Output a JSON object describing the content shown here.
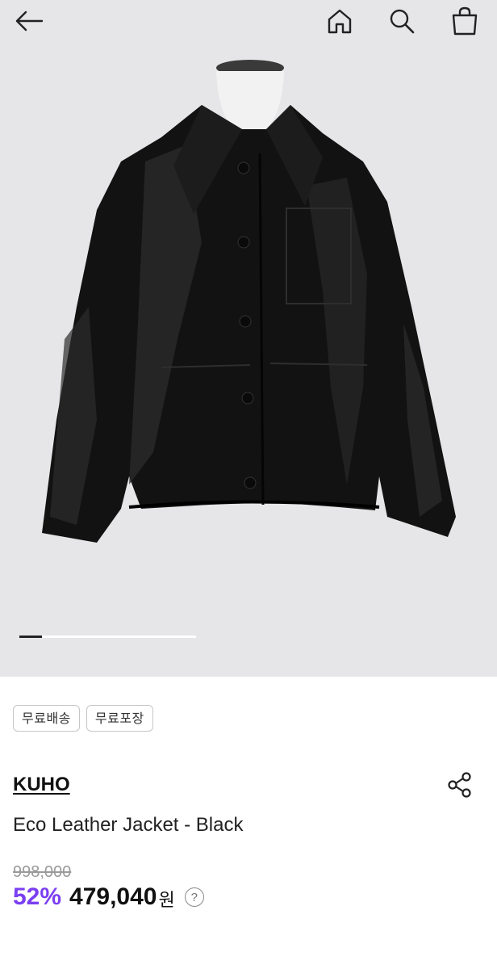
{
  "header": {
    "back_icon": "arrow-left-icon",
    "home_icon": "home-icon",
    "search_icon": "search-icon",
    "cart_icon": "shopping-bag-icon"
  },
  "gallery": {
    "image_subject": "black eco leather jacket on mannequin",
    "progress_fraction": 0.13
  },
  "badges": [
    "무료배송",
    "무료포장"
  ],
  "product": {
    "brand": "KUHO",
    "name": "Eco Leather Jacket - Black",
    "original_price": "998,000",
    "discount": "52%",
    "sale_price": "479,040",
    "currency": "원",
    "help": "?"
  },
  "colors": {
    "accent": "#7b3ff2",
    "hero_bg": "#e6e6e8"
  }
}
